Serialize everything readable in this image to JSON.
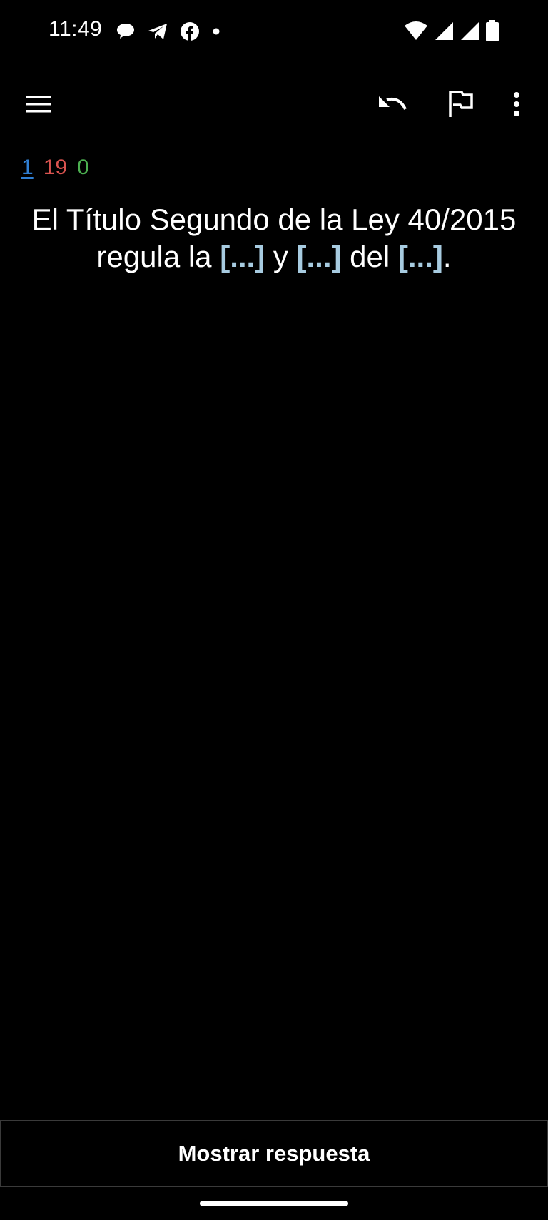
{
  "status_bar": {
    "time": "11:49",
    "left_icons": [
      "chat-bubble-icon",
      "telegram-icon",
      "facebook-icon",
      "notification-dot-icon"
    ],
    "right_icons": [
      "wifi-icon",
      "signal-icon",
      "signal-icon",
      "battery-icon"
    ]
  },
  "toolbar": {
    "icons": [
      "menu-icon",
      "undo-icon",
      "flag-icon",
      "more-vert-icon"
    ]
  },
  "counts": {
    "new": "1",
    "learning": "19",
    "review": "0",
    "colors": {
      "new": "#2f7fd4",
      "learning": "#d9534f",
      "review": "#4caf50"
    }
  },
  "card": {
    "part1": "El Título Segundo de la Ley 40/2015 regula la ",
    "cloze1": "[...]",
    "part2": " y ",
    "cloze2": "[...]",
    "part3": " del ",
    "cloze3": "[...]",
    "part4": ".",
    "cloze_color": "#a7cbe0"
  },
  "answer_bar": {
    "label": "Mostrar respuesta"
  }
}
